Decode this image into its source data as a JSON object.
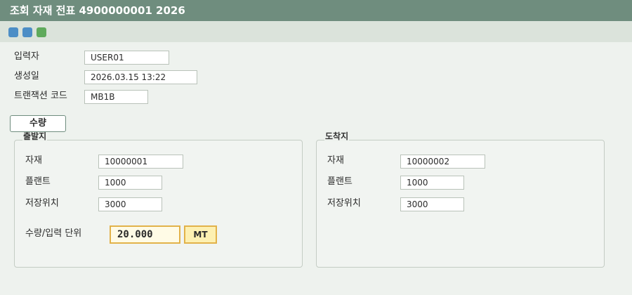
{
  "window": {
    "title": "조회 자재 전표 4900000001 2026"
  },
  "toolbar": {
    "buttons": [
      "blue-square-icon",
      "blue-square-icon",
      "green-square-icon"
    ],
    "colors": [
      "#4d8ec6",
      "#4d8ec6",
      "#5faa5c"
    ]
  },
  "header": {
    "entered_by_label": "입력자",
    "entered_by_value": "USER01",
    "created_on_label": "생성일",
    "created_on_value": "2026.03.15 13:22",
    "tcode_label": "트랜잭션 코드",
    "tcode_value": "MB1B"
  },
  "tab": {
    "label": "수량"
  },
  "source": {
    "title": "출발지",
    "material_label": "자재",
    "material_value": "10000001",
    "plant_label": "플랜트",
    "plant_value": "1000",
    "sloc_label": "저장위치",
    "sloc_value": "3000",
    "qty_label": "수량/입력 단위",
    "qty_value": "20.000",
    "unit_value": "MT"
  },
  "destination": {
    "title": "도착지",
    "material_label": "자재",
    "material_value": "10000002",
    "plant_label": "플랜트",
    "plant_value": "1000",
    "sloc_label": "저장위치",
    "sloc_value": "3000"
  },
  "theme": {
    "titlebar": "#6f8d7e",
    "highlight_border": "#e2b24a",
    "highlight_fill": "#fdf0b2"
  }
}
